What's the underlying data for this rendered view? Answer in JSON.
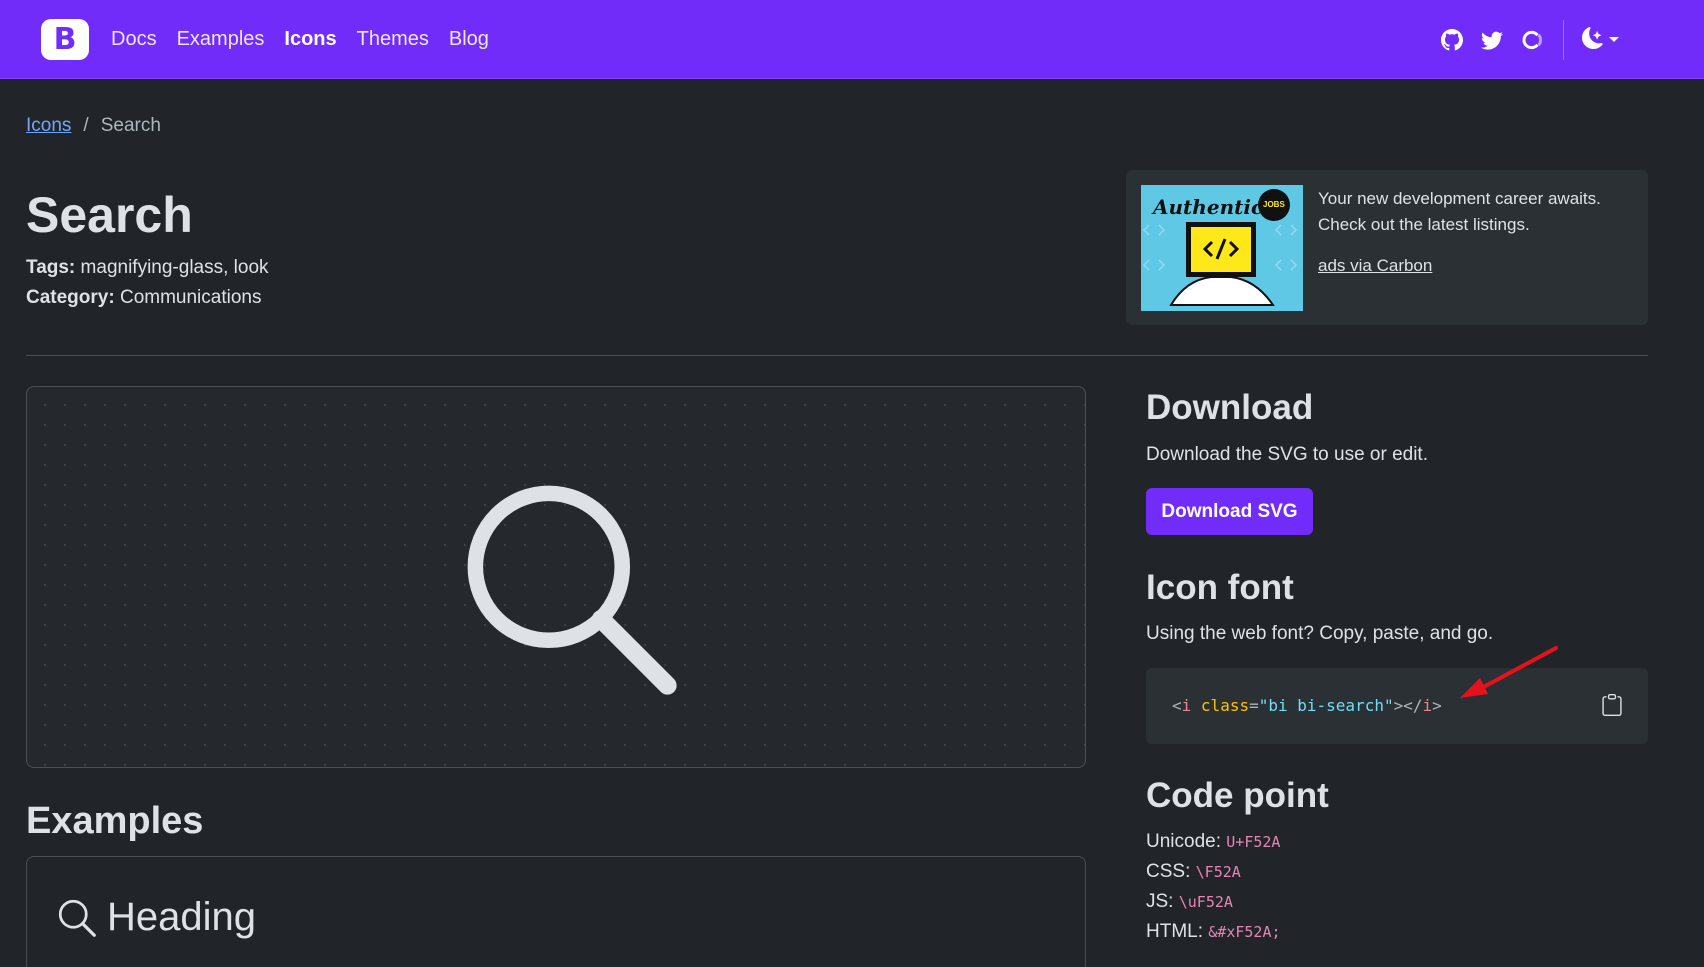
{
  "navbar": {
    "brand_letter": "B",
    "links": [
      {
        "label": "Docs",
        "active": false
      },
      {
        "label": "Examples",
        "active": false
      },
      {
        "label": "Icons",
        "active": true
      },
      {
        "label": "Themes",
        "active": false
      },
      {
        "label": "Blog",
        "active": false
      }
    ],
    "icons": [
      "github-icon",
      "twitter-icon",
      "opencollective-icon"
    ],
    "theme_icon": "moon-stars-icon"
  },
  "breadcrumb": {
    "parent": "Icons",
    "separator": "/",
    "current": "Search"
  },
  "page": {
    "title": "Search",
    "tags_label": "Tags:",
    "tags": "magnifying-glass, look",
    "category_label": "Category:",
    "category": "Communications"
  },
  "ad": {
    "image_logo_text": "Authentic",
    "image_badge": "JOBS",
    "text": "Your new development career awaits. Check out the latest listings.",
    "link": "ads via Carbon"
  },
  "examples": {
    "title": "Examples",
    "heading": "Heading"
  },
  "download": {
    "title": "Download",
    "description": "Download the SVG to use or edit.",
    "button": "Download SVG"
  },
  "icon_font": {
    "title": "Icon font",
    "description": "Using the web font? Copy, paste, and go.",
    "code": {
      "open": "<",
      "tag": "i",
      "attr": "class",
      "eq": "=",
      "value": "\"bi bi-search\"",
      "close_open": "></",
      "close_tag": "i",
      "end": ">"
    },
    "copy_icon": "clipboard-icon"
  },
  "code_point": {
    "title": "Code point",
    "rows": [
      {
        "label": "Unicode:",
        "value": "U+F52A"
      },
      {
        "label": "CSS:",
        "value": "\\F52A"
      },
      {
        "label": "JS:",
        "value": "\\uF52A"
      },
      {
        "label": "HTML:",
        "value": "&#xF52A;"
      }
    ]
  },
  "colors": {
    "brand": "#712cf9",
    "background": "#212529",
    "annotation_arrow": "#e3121b"
  }
}
